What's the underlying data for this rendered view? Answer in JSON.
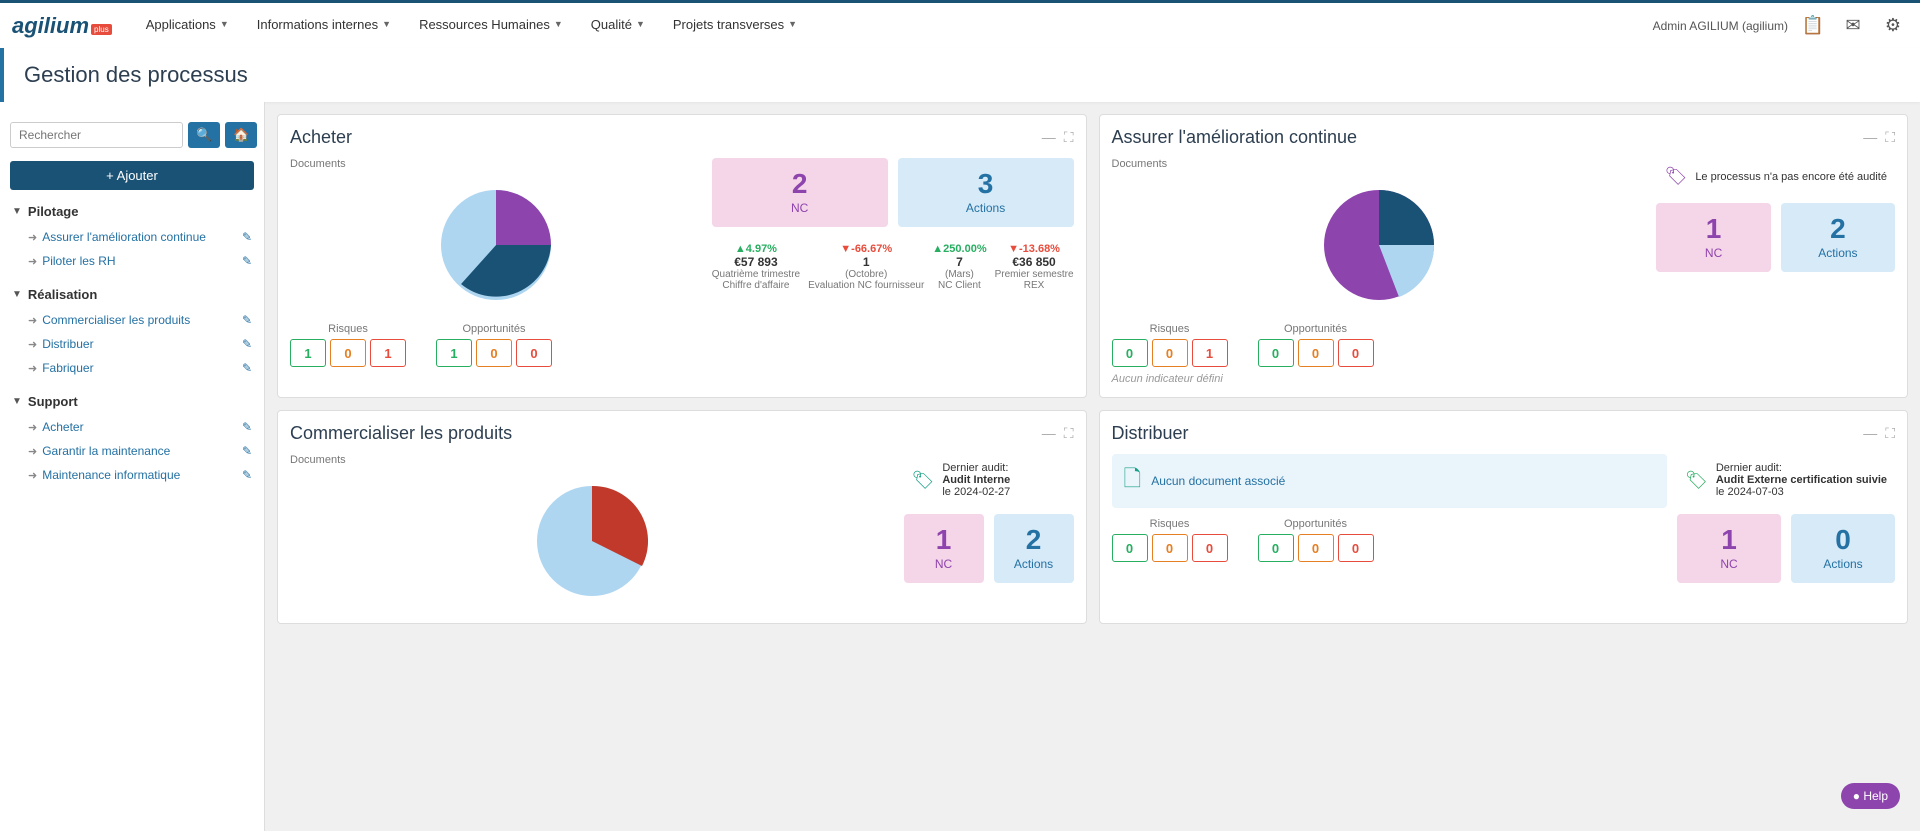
{
  "nav": {
    "logo": "agilium",
    "logo_badge": "plus",
    "items": [
      {
        "label": "Applications",
        "has_arrow": true
      },
      {
        "label": "Informations internes",
        "has_arrow": true
      },
      {
        "label": "Ressources Humaines",
        "has_arrow": true
      },
      {
        "label": "Qualité",
        "has_arrow": true
      },
      {
        "label": "Projets transverses",
        "has_arrow": true
      }
    ],
    "user": "Admin AGILIUM (agilium)"
  },
  "page": {
    "title": "Gestion des processus"
  },
  "sidebar": {
    "search_placeholder": "Rechercher",
    "add_label": "+ Ajouter",
    "sections": [
      {
        "name": "Pilotage",
        "items": [
          {
            "label": "Assurer l'amélioration continue"
          },
          {
            "label": "Piloter les RH"
          }
        ]
      },
      {
        "name": "Réalisation",
        "items": [
          {
            "label": "Commercialiser les produits"
          },
          {
            "label": "Distribuer"
          },
          {
            "label": "Fabriquer"
          }
        ]
      },
      {
        "name": "Support",
        "items": [
          {
            "label": "Acheter"
          },
          {
            "label": "Garantir la maintenance"
          },
          {
            "label": "Maintenance informatique"
          }
        ]
      }
    ]
  },
  "cards": [
    {
      "id": "acheter",
      "title": "Acheter",
      "pie_label": "Documents",
      "pie_segments": [
        {
          "color": "#8e44ad",
          "percent": 25
        },
        {
          "color": "#1a5276",
          "percent": 35
        },
        {
          "color": "#aed6f1",
          "percent": 40
        }
      ],
      "nc": {
        "value": "2",
        "label": "NC"
      },
      "actions": {
        "value": "3",
        "label": "Actions"
      },
      "risks_label": "Risques",
      "risks": [
        "1",
        "0",
        "1"
      ],
      "opps_label": "Opportunités",
      "opps": [
        "1",
        "0",
        "0"
      ],
      "indicators": [
        {
          "change": "+4.97%",
          "up": true,
          "value": "€57 893",
          "period": "Quatrième trimestre",
          "name": "Chiffre d'affaire"
        },
        {
          "change": "-66.67%",
          "up": false,
          "value": "1",
          "period": "(Octobre)",
          "name": "Evaluation NC fournisseur"
        },
        {
          "change": "+250.00%",
          "up": true,
          "value": "7",
          "period": "(Mars)",
          "name": "NC Client"
        },
        {
          "change": "-13.68%",
          "up": false,
          "value": "€36 850",
          "period": "Premier semestre",
          "name": "REX"
        }
      ]
    },
    {
      "id": "amelioration",
      "title": "Assurer l'amélioration continue",
      "pie_label": "Documents",
      "pie_segments": [
        {
          "color": "#8e44ad",
          "percent": 50
        },
        {
          "color": "#1a5276",
          "percent": 20
        },
        {
          "color": "#aed6f1",
          "percent": 30
        }
      ],
      "audit_icon": "tag",
      "audit_msg": "Le processus n'a pas encore été audité",
      "nc": {
        "value": "1",
        "label": "NC"
      },
      "actions": {
        "value": "2",
        "label": "Actions"
      },
      "risks_label": "Risques",
      "risks": [
        "0",
        "0",
        "1"
      ],
      "opps_label": "Opportunités",
      "opps": [
        "0",
        "0",
        "0"
      ],
      "no_indicator": "Aucun indicateur défini"
    },
    {
      "id": "commercialiser",
      "title": "Commercialiser les produits",
      "pie_label": "Documents",
      "pie_segments": [
        {
          "color": "#c0392b",
          "percent": 35
        },
        {
          "color": "#aed6f1",
          "percent": 65
        }
      ],
      "audit_icon": "tag",
      "audit_label": "Dernier audit:",
      "audit_name": "Audit Interne",
      "audit_date": "le 2024-02-27",
      "nc": {
        "value": "1",
        "label": "NC"
      },
      "actions": {
        "value": "2",
        "label": "Actions"
      }
    },
    {
      "id": "distribuer",
      "title": "Distribuer",
      "doc_icon": "file",
      "doc_msg": "Aucun document associé",
      "audit_icon": "tag",
      "audit_label": "Dernier audit:",
      "audit_name": "Audit Externe certification suivie",
      "audit_date": "le 2024-07-03",
      "nc": {
        "value": "1",
        "label": "NC"
      },
      "actions": {
        "value": "0",
        "label": "Actions"
      },
      "risks_label": "Risques",
      "opps_label": "Opportunités"
    }
  ],
  "help": {
    "label": "● Help"
  }
}
